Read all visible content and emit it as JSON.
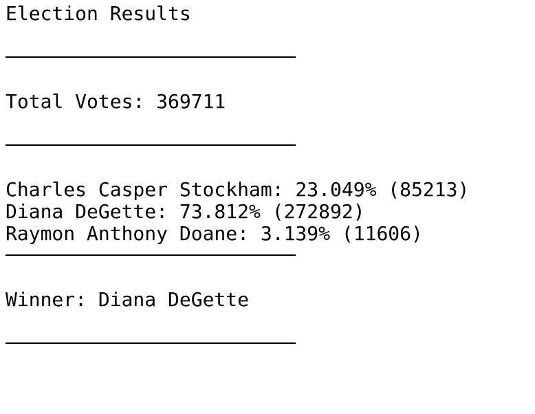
{
  "title": "Election Results",
  "separator": "-------------------------",
  "total_votes_label": "Total Votes: 369711",
  "candidates": [
    {
      "text": "Charles Casper Stockham: 23.049% (85213)"
    },
    {
      "text": "Diana DeGette: 73.812% (272892)"
    },
    {
      "text": "Raymon Anthony Doane: 3.139% (11606)"
    }
  ],
  "winner_label": "Winner: Diana DeGette"
}
